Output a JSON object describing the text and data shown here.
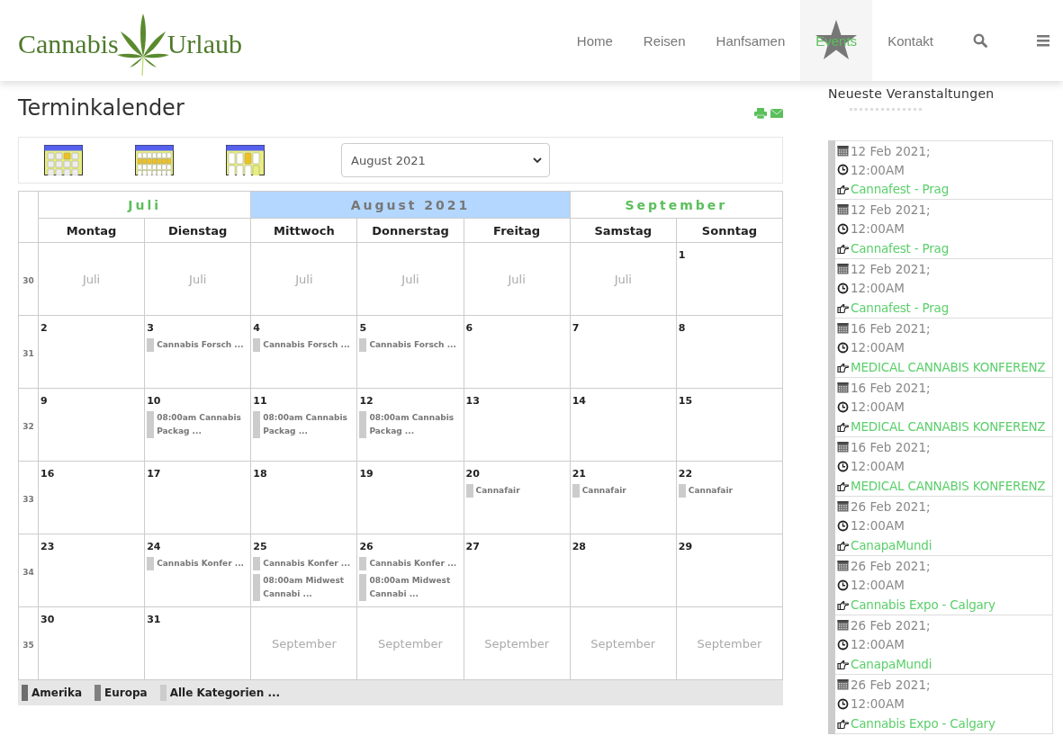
{
  "logo": {
    "left": "Cannabis",
    "right": "Urlaub"
  },
  "nav": [
    {
      "label": "Home",
      "selected": false
    },
    {
      "label": "Reisen",
      "selected": false
    },
    {
      "label": "Hanfsamen",
      "selected": false
    },
    {
      "label": "Events",
      "selected": true
    },
    {
      "label": "Kontakt",
      "selected": false
    }
  ],
  "page_title": "Terminkalender",
  "month_select": {
    "value": "August 2021"
  },
  "calendar": {
    "months": [
      {
        "label": "Juli",
        "selected": false
      },
      {
        "label": "August 2021",
        "selected": true
      },
      {
        "label": "September",
        "selected": false
      }
    ],
    "weekdays": [
      "Montag",
      "Dienstag",
      "Mittwoch",
      "Donnerstag",
      "Freitag",
      "Samstag",
      "Sonntag"
    ],
    "weeks": [
      {
        "number": "30",
        "days": [
          {
            "kind": "other",
            "label": "Juli"
          },
          {
            "kind": "other",
            "label": "Juli"
          },
          {
            "kind": "other",
            "label": "Juli"
          },
          {
            "kind": "other",
            "label": "Juli"
          },
          {
            "kind": "other",
            "label": "Juli"
          },
          {
            "kind": "other",
            "label": "Juli"
          },
          {
            "kind": "day",
            "label": "1"
          }
        ]
      },
      {
        "number": "31",
        "days": [
          {
            "kind": "day",
            "label": "2"
          },
          {
            "kind": "day",
            "label": "3",
            "events": [
              "Cannabis Forsch ..."
            ]
          },
          {
            "kind": "day",
            "label": "4",
            "events": [
              "Cannabis Forsch ..."
            ]
          },
          {
            "kind": "day",
            "label": "5",
            "events": [
              "Cannabis Forsch ..."
            ]
          },
          {
            "kind": "day",
            "label": "6"
          },
          {
            "kind": "day",
            "label": "7"
          },
          {
            "kind": "day",
            "label": "8"
          }
        ]
      },
      {
        "number": "32",
        "days": [
          {
            "kind": "day",
            "label": "9"
          },
          {
            "kind": "day",
            "label": "10",
            "events": [
              "08:00am Cannabis Packag ..."
            ]
          },
          {
            "kind": "day",
            "label": "11",
            "events": [
              "08:00am Cannabis Packag ..."
            ]
          },
          {
            "kind": "day",
            "label": "12",
            "events": [
              "08:00am Cannabis Packag ..."
            ]
          },
          {
            "kind": "day",
            "label": "13"
          },
          {
            "kind": "day",
            "label": "14"
          },
          {
            "kind": "day",
            "label": "15"
          }
        ]
      },
      {
        "number": "33",
        "days": [
          {
            "kind": "day",
            "label": "16"
          },
          {
            "kind": "day",
            "label": "17"
          },
          {
            "kind": "day",
            "label": "18"
          },
          {
            "kind": "day",
            "label": "19"
          },
          {
            "kind": "day",
            "label": "20",
            "events": [
              "Cannafair"
            ]
          },
          {
            "kind": "day",
            "label": "21",
            "events": [
              "Cannafair"
            ]
          },
          {
            "kind": "day",
            "label": "22",
            "events": [
              "Cannafair"
            ]
          }
        ]
      },
      {
        "number": "34",
        "days": [
          {
            "kind": "day",
            "label": "23"
          },
          {
            "kind": "day",
            "label": "24",
            "events": [
              "Cannabis Konfer ..."
            ]
          },
          {
            "kind": "day",
            "label": "25",
            "events": [
              "Cannabis Konfer ...",
              "08:00am Midwest Cannabi ..."
            ]
          },
          {
            "kind": "day",
            "label": "26",
            "events": [
              "Cannabis Konfer ...",
              "08:00am Midwest Cannabi ..."
            ]
          },
          {
            "kind": "day",
            "label": "27"
          },
          {
            "kind": "day",
            "label": "28"
          },
          {
            "kind": "day",
            "label": "29"
          }
        ]
      },
      {
        "number": "35",
        "days": [
          {
            "kind": "day",
            "label": "30"
          },
          {
            "kind": "day",
            "label": "31"
          },
          {
            "kind": "other",
            "label": "September"
          },
          {
            "kind": "other",
            "label": "September"
          },
          {
            "kind": "other",
            "label": "September"
          },
          {
            "kind": "other",
            "label": "September"
          },
          {
            "kind": "other",
            "label": "September"
          }
        ]
      }
    ]
  },
  "legend": [
    {
      "label": "Amerika",
      "color": "#6e6e6e"
    },
    {
      "label": "Europa",
      "color": "#808080"
    },
    {
      "label": "Alle Kategorien ...",
      "color": "#cccccc"
    }
  ],
  "sidebar": {
    "title": "Neueste Veranstaltungen",
    "events": [
      {
        "date": "12 Feb 2021;",
        "time": "12:00AM",
        "title": "Cannafest - Prag"
      },
      {
        "date": "12 Feb 2021;",
        "time": "12:00AM",
        "title": "Cannafest - Prag"
      },
      {
        "date": "12 Feb 2021;",
        "time": "12:00AM",
        "title": "Cannafest - Prag"
      },
      {
        "date": "16 Feb 2021;",
        "time": "12:00AM",
        "title": "MEDICAL CANNABIS KONFERENZ"
      },
      {
        "date": "16 Feb 2021;",
        "time": "12:00AM",
        "title": "MEDICAL CANNABIS KONFERENZ"
      },
      {
        "date": "16 Feb 2021;",
        "time": "12:00AM",
        "title": "MEDICAL CANNABIS KONFERENZ"
      },
      {
        "date": "26 Feb 2021;",
        "time": "12:00AM",
        "title": "CanapaMundi"
      },
      {
        "date": "26 Feb 2021;",
        "time": "12:00AM",
        "title": "Cannabis Expo - Calgary"
      },
      {
        "date": "26 Feb 2021;",
        "time": "12:00AM",
        "title": "CanapaMundi"
      },
      {
        "date": "26 Feb 2021;",
        "time": "12:00AM",
        "title": "Cannabis Expo - Calgary"
      }
    ]
  }
}
